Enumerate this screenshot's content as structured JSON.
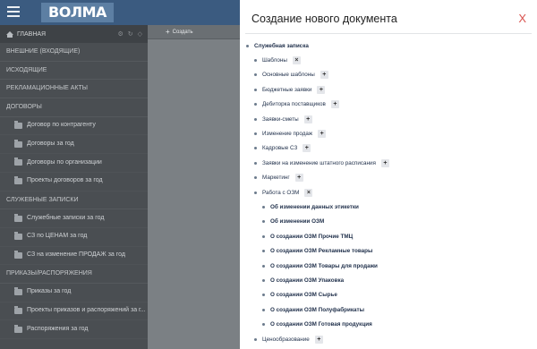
{
  "header": {
    "logo_text": "ВОЛМА"
  },
  "sidebar": {
    "home_label": "ГЛАВНАЯ",
    "items": [
      {
        "type": "section",
        "label": "ВНЕШНИЕ (ВХОДЯЩИЕ)"
      },
      {
        "type": "section",
        "label": "ИСХОДЯЩИЕ"
      },
      {
        "type": "section",
        "label": "РЕКЛАМАЦИОННЫЕ АКТЫ"
      },
      {
        "type": "section",
        "label": "ДОГОВОРЫ"
      },
      {
        "type": "item",
        "label": "Договор по контрагенту"
      },
      {
        "type": "item",
        "label": "Договоры за год"
      },
      {
        "type": "item",
        "label": "Договоры по организации"
      },
      {
        "type": "item",
        "label": "Проекты договоров за год"
      },
      {
        "type": "section",
        "label": "СЛУЖЕБНЫЕ ЗАПИСКИ"
      },
      {
        "type": "item",
        "label": "Служебные записки за год"
      },
      {
        "type": "item",
        "label": "СЗ по ЦЕНАМ за год"
      },
      {
        "type": "item",
        "label": "СЗ на изменение ПРОДАЖ за год"
      },
      {
        "type": "section",
        "label": "ПРИКАЗЫ/РАСПОРЯЖЕНИЯ"
      },
      {
        "type": "item",
        "label": "Приказы за год"
      },
      {
        "type": "item",
        "label": "Проекты приказов и распоряжений за г..."
      },
      {
        "type": "item",
        "label": "Распоряжения за год"
      }
    ]
  },
  "middle": {
    "create_label": "Создать"
  },
  "modal": {
    "title": "Создание нового документа",
    "close_symbol": "Х",
    "tree": [
      {
        "level": 0,
        "label": "Служебная записка",
        "action": ""
      },
      {
        "level": 1,
        "label": "Шаблоны",
        "action": "×"
      },
      {
        "level": 1,
        "label": "Основные шаблоны",
        "action": "+"
      },
      {
        "level": 1,
        "label": "Бюджетные заявки",
        "action": "+"
      },
      {
        "level": 1,
        "label": "Дебиторка поставщиков",
        "action": "+"
      },
      {
        "level": 1,
        "label": "Заявки-сметы",
        "action": "+"
      },
      {
        "level": 1,
        "label": "Изменение продаж",
        "action": "+"
      },
      {
        "level": 1,
        "label": "Кадровые СЗ",
        "action": "+"
      },
      {
        "level": 1,
        "label": "Заявки на изменение штатного расписания",
        "action": "+"
      },
      {
        "level": 1,
        "label": "Маркетинг",
        "action": "+"
      },
      {
        "level": 1,
        "label": "Работа с ОЗМ",
        "action": "×"
      },
      {
        "level": 2,
        "label": "Об изменении данных этикетки",
        "action": ""
      },
      {
        "level": 2,
        "label": "Об изменении ОЗМ",
        "action": ""
      },
      {
        "level": 2,
        "label": "О создании ОЗМ Прочие ТМЦ",
        "action": ""
      },
      {
        "level": 2,
        "label": "О создании ОЗМ Рекламные товары",
        "action": ""
      },
      {
        "level": 2,
        "label": "О создании ОЗМ Товары для продажи",
        "action": ""
      },
      {
        "level": 2,
        "label": "О создании ОЗМ Упаковка",
        "action": ""
      },
      {
        "level": 2,
        "label": "О создании ОЗМ Сырье",
        "action": ""
      },
      {
        "level": 2,
        "label": "О создании ОЗМ Полуфабрикаты",
        "action": ""
      },
      {
        "level": 2,
        "label": "О создании ОЗМ Готовая продукция",
        "action": ""
      },
      {
        "level": 1,
        "label": "Ценообразование",
        "action": "+"
      }
    ]
  }
}
